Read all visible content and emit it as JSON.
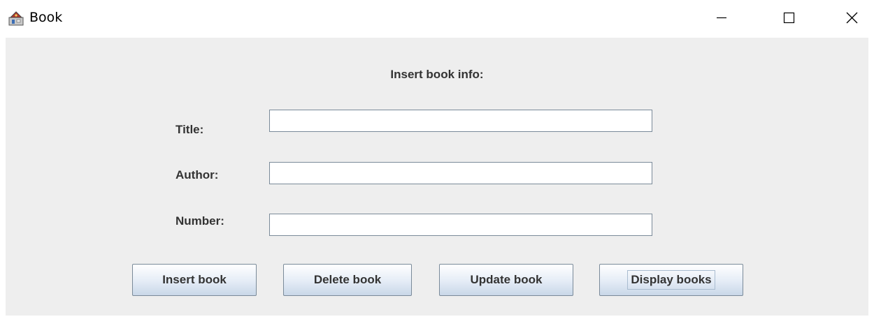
{
  "window": {
    "title": "Book",
    "icon": "java-app-icon"
  },
  "form": {
    "heading": "Insert book info:",
    "fields": [
      {
        "label": "Title:",
        "value": ""
      },
      {
        "label": "Author:",
        "value": ""
      },
      {
        "label": "Number:",
        "value": ""
      }
    ]
  },
  "buttons": [
    {
      "label": "Insert book"
    },
    {
      "label": "Delete book"
    },
    {
      "label": "Update book"
    },
    {
      "label": "Display books",
      "focused": true
    }
  ]
}
